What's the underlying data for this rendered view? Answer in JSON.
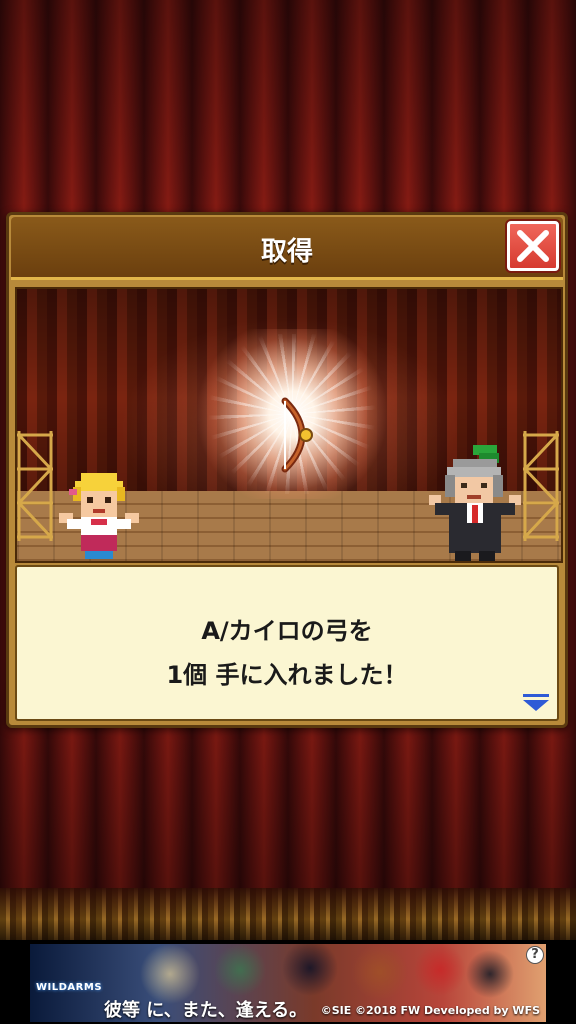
{
  "dialog": {
    "title": "取得",
    "message_line_1": "A/カイロの弓を",
    "message_line_2": "1個  手に入れました！"
  },
  "icons": {
    "close": "close-icon",
    "item": "bow-icon",
    "next": "next-arrow-icon",
    "help": "help-icon"
  },
  "ad": {
    "logo": "WILDARMS",
    "tagline": "彼等 に、また、逢える。",
    "copyright": "©SIE ©2018 FW Developed by WFS",
    "help_label": "?"
  },
  "colors": {
    "accent_gold": "#e2b64a",
    "close_red": "#d63a30",
    "message_bg": "#fbf6d2",
    "arrow_blue": "#2e5ad6"
  }
}
